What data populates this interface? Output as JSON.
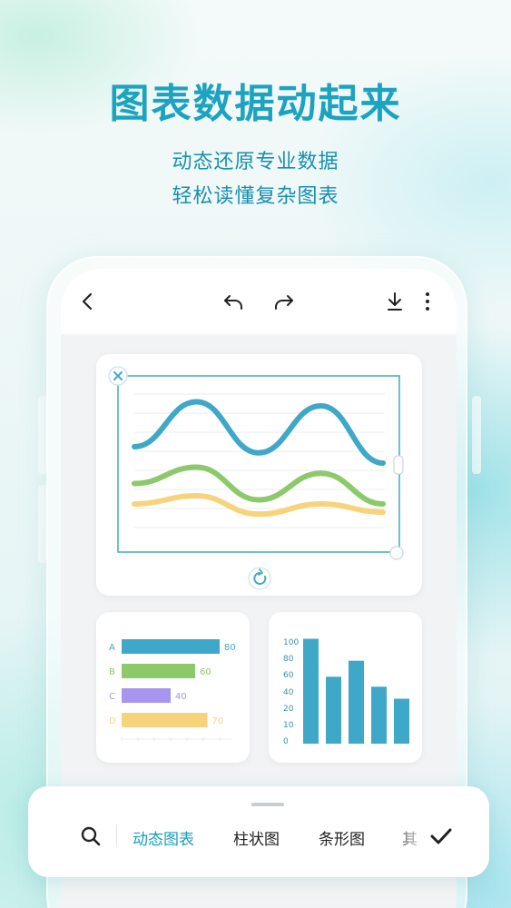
{
  "hero": {
    "title": "图表数据动起来",
    "subtitle_line1": "动态还原专业数据",
    "subtitle_line2": "轻松读懂复杂图表"
  },
  "toolbar": {
    "back_icon": "chevron-left-icon",
    "undo_icon": "undo-icon",
    "redo_icon": "redo-icon",
    "download_icon": "download-icon",
    "more_icon": "more-vertical-icon"
  },
  "colors": {
    "accent": "#1a9dbd",
    "blue": "#3fa8c8",
    "green": "#8cc96a",
    "yellow": "#f7d47c",
    "purple": "#a895f0"
  },
  "bottom_bar": {
    "tabs": [
      "动态图表",
      "柱状图",
      "条形图",
      "其"
    ],
    "active_tab": 0
  },
  "chart_data": [
    {
      "type": "line",
      "series": [
        {
          "values": [
            48,
            70,
            45,
            68,
            40
          ]
        },
        {
          "values": [
            30,
            38,
            22,
            35,
            20
          ]
        },
        {
          "values": [
            20,
            24,
            15,
            20,
            16
          ]
        }
      ],
      "grid": true
    },
    {
      "type": "bar",
      "orientation": "horizontal",
      "categories": [
        "A",
        "B",
        "C",
        "D"
      ],
      "values": [
        80,
        60,
        40,
        70
      ],
      "colors": [
        "#3fa8c8",
        "#8cc96a",
        "#a895f0",
        "#f7d47c"
      ]
    },
    {
      "type": "bar",
      "orientation": "vertical",
      "values": [
        105,
        67,
        83,
        57,
        45
      ],
      "yticks": [
        "100",
        "80",
        "60",
        "40",
        "20",
        "10",
        "0"
      ],
      "ylim": [
        0,
        110
      ],
      "color": "#3fa8c8"
    }
  ]
}
